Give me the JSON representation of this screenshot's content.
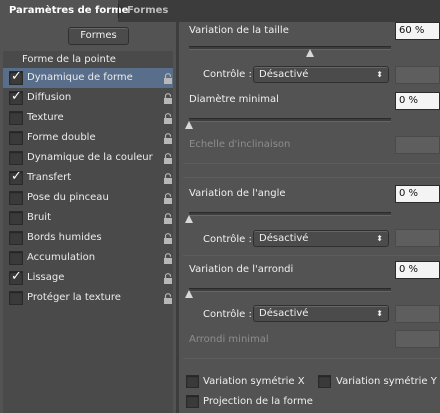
{
  "tabs": {
    "active": "Paramètres de forme",
    "inactive": "Formes"
  },
  "formes_button": "Formes",
  "list_header": "Forme de la pointe",
  "items": [
    {
      "label": "Dynamique de forme",
      "checked": true,
      "selected": true
    },
    {
      "label": "Diffusion",
      "checked": true,
      "selected": false
    },
    {
      "label": "Texture",
      "checked": false,
      "selected": false
    },
    {
      "label": "Forme double",
      "checked": false,
      "selected": false
    },
    {
      "label": "Dynamique de la couleur",
      "checked": false,
      "selected": false
    },
    {
      "label": "Transfert",
      "checked": true,
      "selected": false
    },
    {
      "label": "Pose du pinceau",
      "checked": false,
      "selected": false
    },
    {
      "label": "Bruit",
      "checked": false,
      "selected": false
    },
    {
      "label": "Bords humides",
      "checked": false,
      "selected": false
    },
    {
      "label": "Accumulation",
      "checked": false,
      "selected": false
    },
    {
      "label": "Lissage",
      "checked": true,
      "selected": false
    },
    {
      "label": "Protéger la texture",
      "checked": false,
      "selected": false
    }
  ],
  "settings": {
    "size_jitter": {
      "label": "Variation de la taille",
      "value": "60 %",
      "level": 60
    },
    "size_control": {
      "label": "Contrôle :",
      "value": "Désactivé"
    },
    "min_diameter": {
      "label": "Diamètre minimal",
      "value": "0 %",
      "level": 0
    },
    "tilt_scale": {
      "label": "Echelle d'inclinaison"
    },
    "angle_jitter": {
      "label": "Variation de l'angle",
      "value": "0 %",
      "level": 0
    },
    "angle_control": {
      "label": "Contrôle :",
      "value": "Désactivé"
    },
    "roundness_jitter": {
      "label": "Variation de l'arrondi",
      "value": "0 %",
      "level": 0
    },
    "roundness_control": {
      "label": "Contrôle :",
      "value": "Désactivé"
    },
    "min_roundness": {
      "label": "Arrondi minimal"
    },
    "flip_x": {
      "label": "Variation symétrie X",
      "checked": false
    },
    "flip_y": {
      "label": "Variation symétrie Y",
      "checked": false
    },
    "projection": {
      "label": "Projection de la forme",
      "checked": false
    }
  },
  "icons": {
    "check": "check-icon",
    "lock": "lock-icon",
    "dropdown": "updown-arrows-icon"
  },
  "colors": {
    "selection": "#596e8a",
    "panel": "#535353",
    "list_bg": "#4a4a4a"
  }
}
